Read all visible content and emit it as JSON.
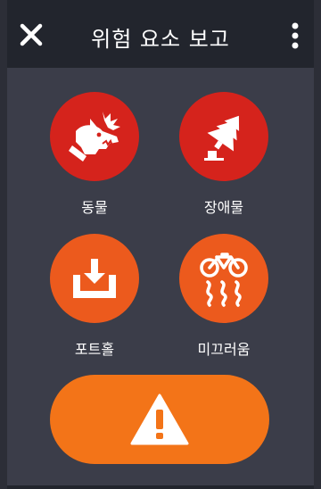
{
  "header": {
    "title": "위험 요소 보고",
    "close_icon": "close-icon",
    "menu_icon": "more-vertical-icon"
  },
  "hazards": [
    {
      "label": "동물",
      "icon": "angry-dog-icon",
      "color": "#d5231c"
    },
    {
      "label": "장애물",
      "icon": "fallen-tree-icon",
      "color": "#d5231c"
    },
    {
      "label": "포트홀",
      "icon": "pothole-icon",
      "color": "#ec5a1d"
    },
    {
      "label": "미끄러움",
      "icon": "slippery-bike-icon",
      "color": "#ec5a1d"
    }
  ],
  "general_hazard": {
    "icon": "warning-triangle-icon",
    "color": "#f37418"
  },
  "colors": {
    "background": "#3b3d49",
    "header": "#22252d"
  }
}
